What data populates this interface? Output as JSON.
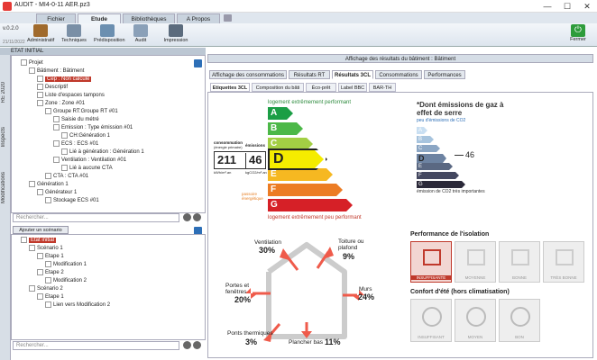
{
  "window": {
    "title": "AUDIT - MI4-0-11 AER.pz3",
    "minimize": "—",
    "maximize": "☐",
    "close": "✕"
  },
  "app": {
    "version": "v.0.2.0",
    "date": "21/11/2022"
  },
  "ribbon": {
    "tabs": [
      {
        "label": "Fichier"
      },
      {
        "label": "Etude"
      },
      {
        "label": "Bibliothèques"
      },
      {
        "label": "A Propos"
      }
    ],
    "buttons": [
      {
        "label": "Administratif"
      },
      {
        "label": "Techniques"
      },
      {
        "label": "Prédisposition"
      },
      {
        "label": "Audit"
      },
      {
        "label": "Impression"
      }
    ],
    "close_label": "Fermer"
  },
  "left": {
    "etat": "ETAT INITIAL",
    "side_tabs": [
      "RE 2020",
      "Inspects",
      "Modifications"
    ],
    "tree": [
      {
        "label": "Projet",
        "indent": 0
      },
      {
        "label": "Bâtiment : Bâtiment",
        "indent": 1
      },
      {
        "label": "Cep : Non calculé",
        "indent": 2,
        "selected": true
      },
      {
        "label": "Descriptif",
        "indent": 2
      },
      {
        "label": "Liste d'espaces tampons",
        "indent": 2
      },
      {
        "label": "Zone : Zone #01",
        "indent": 2
      },
      {
        "label": "Groupe RT:Groupe RT #01",
        "indent": 3
      },
      {
        "label": "Saisie du métré",
        "indent": 4
      },
      {
        "label": "Emission : Type émission #01",
        "indent": 4
      },
      {
        "label": "CH:Génération 1",
        "indent": 5
      },
      {
        "label": "ECS : ECS #01",
        "indent": 4
      },
      {
        "label": "Lié à génération : Génération 1",
        "indent": 5
      },
      {
        "label": "Ventilation : Ventilation #01",
        "indent": 4
      },
      {
        "label": "Lié à aucune CTA",
        "indent": 5
      },
      {
        "label": "CTA : CTA #01",
        "indent": 3
      },
      {
        "label": "Génération 1",
        "indent": 1
      },
      {
        "label": "Générateur 1",
        "indent": 2
      },
      {
        "label": "Stockage ECS #01",
        "indent": 3
      }
    ],
    "search_placeholder": "Rechercher...",
    "add_scenario": "Ajouter un scénario",
    "scenarios": [
      {
        "label": "Etat initial",
        "indent": 0,
        "selected": true
      },
      {
        "label": "Scénario 1",
        "indent": 1
      },
      {
        "label": "Etape 1",
        "indent": 2
      },
      {
        "label": "Modification 1",
        "indent": 3
      },
      {
        "label": "Etape 2",
        "indent": 2
      },
      {
        "label": "Modification 2",
        "indent": 3
      },
      {
        "label": "Scénario 2",
        "indent": 1
      },
      {
        "label": "Etape 1",
        "indent": 2
      },
      {
        "label": "Lien vers Modification 2",
        "indent": 3
      }
    ]
  },
  "right": {
    "header": "Affichage des résultats du bâtiment : Bâtiment",
    "tabs": [
      {
        "label": "Affichage des consommations"
      },
      {
        "label": "Résultats RT"
      },
      {
        "label": "Résultats 3CL"
      },
      {
        "label": "Consommations"
      },
      {
        "label": "Performances"
      }
    ],
    "subtabs": [
      {
        "label": "Etiquettes 3CL"
      },
      {
        "label": "Composition du bâti"
      },
      {
        "label": "Éco-prêt"
      },
      {
        "label": "Label BBC"
      },
      {
        "label": "BAR-TH"
      }
    ]
  },
  "energy": {
    "top_text": "logement extrêmement performant",
    "bottom_text": "logement extrêmement peu performant",
    "conso_label": "consommation",
    "conso_sub": "(énergie primaire)",
    "emission_label": "émissions",
    "value_conso": "211",
    "value_ges": "46",
    "unit_conso": "kWh/m².an",
    "unit_ges": "kgCO2/m².an",
    "passoire": "passoire énergétique",
    "classes": [
      {
        "letter": "A",
        "color": "#1b9e45"
      },
      {
        "letter": "B",
        "color": "#4cb848"
      },
      {
        "letter": "C",
        "color": "#a3cf44"
      },
      {
        "letter": "D",
        "color": "#f5ec00"
      },
      {
        "letter": "E",
        "color": "#f6b821"
      },
      {
        "letter": "F",
        "color": "#ec7c24"
      },
      {
        "letter": "G",
        "color": "#d62027"
      }
    ],
    "current": "D"
  },
  "ges": {
    "title": "*Dont émissions de gaz à effet de serre",
    "sub": "peu d'émissions de CO2",
    "bottom": "émission de CO2 très importantes",
    "value": "46",
    "current": "D",
    "classes": [
      {
        "letter": "A",
        "color": "#c9dff2"
      },
      {
        "letter": "B",
        "color": "#a7c4de"
      },
      {
        "letter": "C",
        "color": "#8ba6c4"
      },
      {
        "letter": "D",
        "color": "#6d83a2"
      },
      {
        "letter": "E",
        "color": "#5a6882"
      },
      {
        "letter": "F",
        "color": "#43475f"
      },
      {
        "letter": "G",
        "color": "#2a2838"
      }
    ]
  },
  "losses": {
    "ventilation": {
      "label": "Ventilation",
      "pct": "30%"
    },
    "toiture": {
      "label": "Toiture ou plafond",
      "pct": "9%"
    },
    "portes": {
      "label": "Portes et fenêtres",
      "pct": "20%"
    },
    "murs": {
      "label": "Murs",
      "pct": "24%"
    },
    "ponts": {
      "label": "Ponts thermiques",
      "pct": "3%"
    },
    "plancher": {
      "label": "Plancher bas",
      "pct": "11%"
    }
  },
  "isolation": {
    "title": "Performance de l'isolation",
    "levels": [
      "INSUFFISANTE",
      "MOYENNE",
      "BONNE",
      "TRÈS BONNE"
    ],
    "current": "INSUFFISANTE"
  },
  "confort": {
    "title": "Confort d'été (hors climatisation)",
    "levels": [
      "INSUFFISANT",
      "MOYEN",
      "BON"
    ]
  }
}
